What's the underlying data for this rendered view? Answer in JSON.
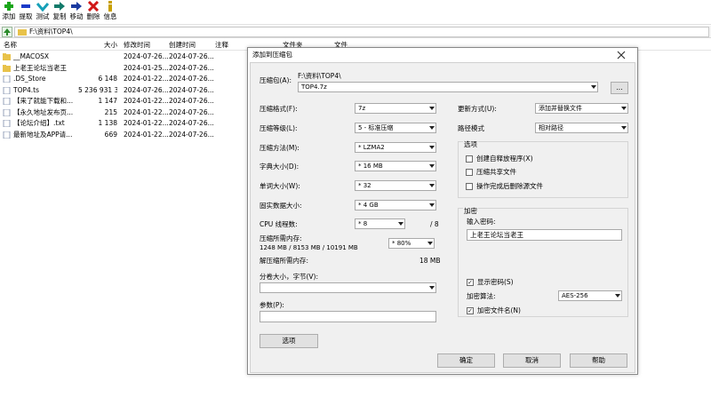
{
  "toolbar": {
    "buttons": [
      {
        "label": "添加",
        "icon": "plus-icon",
        "color": "#1aa51a"
      },
      {
        "label": "提取",
        "icon": "minus-icon",
        "color": "#1a3ac8"
      },
      {
        "label": "测试",
        "icon": "check-icon",
        "color": "#17a0b8"
      },
      {
        "label": "复制",
        "icon": "copy-arrow-icon",
        "color": "#127a6a"
      },
      {
        "label": "移动",
        "icon": "move-arrow-icon",
        "color": "#1a3aa0"
      },
      {
        "label": "删除",
        "icon": "delete-x-icon",
        "color": "#d01818"
      },
      {
        "label": "信息",
        "icon": "info-icon",
        "color": "#c8a000"
      }
    ]
  },
  "address": {
    "path": "F:\\资料\\TOP4\\"
  },
  "list": {
    "columns": [
      "名称",
      "大小",
      "修改时间",
      "创建时间",
      "注释",
      "文件夹",
      "文件"
    ],
    "rows": [
      {
        "name": "__MACOSX",
        "size": "",
        "modified": "2024-07-26...",
        "created": "2024-07-26...",
        "type": "folder"
      },
      {
        "name": "上老王论坛当老王",
        "size": "",
        "modified": "2024-01-25...",
        "created": "2024-07-26...",
        "type": "folder"
      },
      {
        "name": ".DS_Store",
        "size": "6 148",
        "modified": "2024-01-22...",
        "created": "2024-07-26...",
        "type": "file"
      },
      {
        "name": "TOP4.ts",
        "size": "5 236 931 3...",
        "modified": "2024-07-26...",
        "created": "2024-07-26...",
        "type": "file"
      },
      {
        "name": "【来了就能下载和...",
        "size": "1 147",
        "modified": "2024-01-22...",
        "created": "2024-07-26...",
        "type": "file"
      },
      {
        "name": "【永久地址发布页...",
        "size": "215",
        "modified": "2024-01-22...",
        "created": "2024-07-26...",
        "type": "file"
      },
      {
        "name": "【论坛介绍】.txt",
        "size": "1 138",
        "modified": "2024-01-22...",
        "created": "2024-07-26...",
        "type": "file"
      },
      {
        "name": "最新地址及APP请...",
        "size": "669",
        "modified": "2024-01-22...",
        "created": "2024-07-26...",
        "type": "file"
      }
    ]
  },
  "dialog": {
    "title": "添加到压缩包",
    "close": "X",
    "archive_label": "压缩包(A):",
    "archive_dir": "F:\\资料\\TOP4\\",
    "archive_name": "TOP4.7z",
    "browse": "...",
    "format_label": "压缩格式(F):",
    "format_value": "7z",
    "level_label": "压缩等级(L):",
    "level_value": "5 - 标准压缩",
    "method_label": "压缩方法(M):",
    "method_value": "* LZMA2",
    "dict_label": "字典大小(D):",
    "dict_value": "* 16 MB",
    "word_label": "单词大小(W):",
    "word_value": "* 32",
    "solid_label": "固实数据大小:",
    "solid_value": "* 4 GB",
    "cpu_label": "CPU 线程数:",
    "cpu_value": "* 8",
    "cpu_max": "/ 8",
    "mem_label": "压缩所需内存:",
    "mem_value": "1248 MB / 8153 MB / 10191 MB",
    "mem_percent": "* 80%",
    "decomp_label": "解压缩所需内存:",
    "decomp_value": "18 MB",
    "split_label": "分卷大小，字节(V):",
    "split_value": "",
    "params_label": "参数(P):",
    "params_value": "",
    "options_btn": "选项",
    "update_label": "更新方式(U):",
    "update_value": "添加并替换文件",
    "pathmode_label": "路径模式",
    "pathmode_value": "相对路径",
    "options_group": "选项",
    "opt_sfx": "创建自释放程序(X)",
    "opt_shared": "压缩共享文件",
    "opt_delete": "操作完成后删除源文件",
    "encrypt_group": "加密",
    "password_label": "输入密码:",
    "password_value": "上老王论坛当老王",
    "show_password": "显示密码(S)",
    "enc_method_label": "加密算法:",
    "enc_method_value": "AES-256",
    "encrypt_names": "加密文件名(N)",
    "ok": "确定",
    "cancel": "取消",
    "help": "帮助"
  }
}
